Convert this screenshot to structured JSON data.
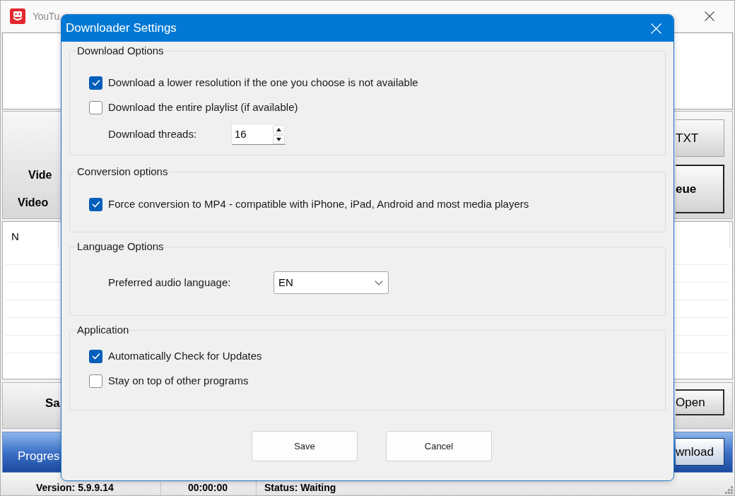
{
  "main_window": {
    "title": "YouTu",
    "panel_labels": [
      "Vide",
      "Video"
    ],
    "panel_buttons": [
      {
        "label": "TXT",
        "bold": false
      },
      {
        "label": "eue",
        "bold": true
      }
    ],
    "list": {
      "column_1": "N"
    },
    "save_row": {
      "label": "Sa",
      "button": "Open"
    },
    "progress_row": {
      "label": "Progres",
      "button": "wnload"
    },
    "status_bar": [
      "Version: 5.9.9.14",
      "00:00:00",
      "Status: Waiting"
    ]
  },
  "dialog": {
    "title": "Downloader Settings",
    "groups": [
      {
        "title": "Download Options",
        "items": [
          {
            "kind": "checkbox",
            "label": "Download a lower resolution if the one you choose is not available",
            "checked": true
          },
          {
            "kind": "checkbox",
            "label": "Download the entire playlist (if available)",
            "checked": false
          },
          {
            "kind": "spinner",
            "label": "Download threads:",
            "value": "16"
          }
        ]
      },
      {
        "title": "Conversion options",
        "items": [
          {
            "kind": "checkbox",
            "label": "Force conversion to MP4 - compatible with iPhone, iPad, Android and most media players",
            "checked": true
          }
        ]
      },
      {
        "title": "Language Options",
        "items": [
          {
            "kind": "dropdown",
            "label": "Preferred audio language:",
            "value": "EN"
          }
        ]
      },
      {
        "title": "Application",
        "items": [
          {
            "kind": "checkbox",
            "label": "Automatically Check for Updates",
            "checked": true
          },
          {
            "kind": "checkbox",
            "label": "Stay on top of other programs",
            "checked": false
          }
        ]
      }
    ],
    "buttons": [
      "Save",
      "Cancel"
    ]
  }
}
